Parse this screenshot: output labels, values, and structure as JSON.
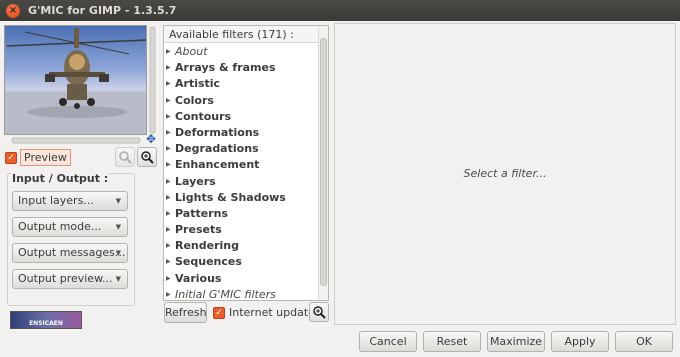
{
  "window": {
    "title": "G'MIC for GIMP - 1.3.5.7"
  },
  "preview": {
    "checkbox_label": "Preview",
    "checked": true
  },
  "io": {
    "group_title": "Input / Output :",
    "combos": [
      "Input layers...",
      "Output mode...",
      "Output messages...",
      "Output preview..."
    ]
  },
  "logo_text": "ENSICAEN",
  "filters": {
    "header": "Available filters (171) :",
    "items": [
      {
        "label": "About",
        "italic": true
      },
      {
        "label": "Arrays & frames",
        "italic": false
      },
      {
        "label": "Artistic",
        "italic": false
      },
      {
        "label": "Colors",
        "italic": false
      },
      {
        "label": "Contours",
        "italic": false
      },
      {
        "label": "Deformations",
        "italic": false
      },
      {
        "label": "Degradations",
        "italic": false
      },
      {
        "label": "Enhancement",
        "italic": false
      },
      {
        "label": "Layers",
        "italic": false
      },
      {
        "label": "Lights & Shadows",
        "italic": false
      },
      {
        "label": "Patterns",
        "italic": false
      },
      {
        "label": "Presets",
        "italic": false
      },
      {
        "label": "Rendering",
        "italic": false
      },
      {
        "label": "Sequences",
        "italic": false
      },
      {
        "label": "Various",
        "italic": false
      },
      {
        "label": "Initial G'MIC filters",
        "italic": true
      }
    ],
    "refresh_label": "Refresh",
    "internet_updates_label": "Internet updates",
    "internet_updates_checked": true
  },
  "settings": {
    "placeholder": "Select a filter..."
  },
  "buttons": {
    "cancel": "Cancel",
    "reset": "Reset",
    "maximize": "Maximize",
    "apply": "Apply",
    "ok": "OK"
  },
  "colors": {
    "accent": "#e9602c",
    "titlebar": "#3c3b37"
  }
}
